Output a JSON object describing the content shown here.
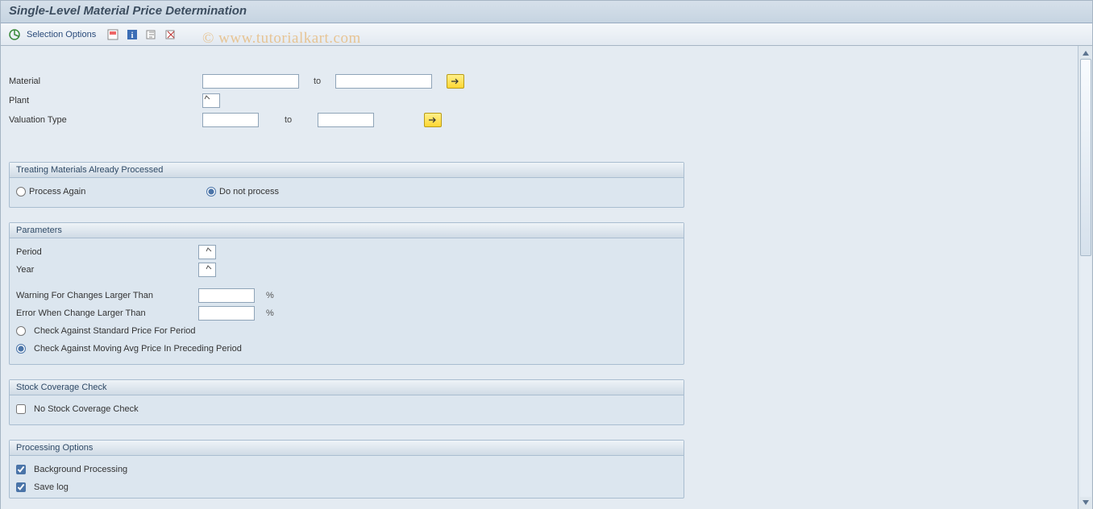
{
  "title": "Single-Level Material Price Determination",
  "toolbar": {
    "selection_options": "Selection Options"
  },
  "watermark": "© www.tutorialkart.com",
  "selection": {
    "material_label": "Material",
    "material_from": "",
    "material_to": "",
    "to_label": "to",
    "plant_label": "Plant",
    "plant_value": "",
    "valuation_label": "Valuation Type",
    "valuation_from": "",
    "valuation_to": ""
  },
  "group_processed": {
    "title": "Treating Materials Already Processed",
    "option_process_again": "Process Again",
    "option_do_not_process": "Do not process"
  },
  "group_parameters": {
    "title": "Parameters",
    "period_label": "Period",
    "period_value": "",
    "year_label": "Year",
    "year_value": "",
    "warning_label": "Warning For Changes Larger Than",
    "warning_value": "",
    "error_label": "Error When Change Larger Than",
    "error_value": "",
    "percent": "%",
    "option_standard": "Check Against Standard Price For Period",
    "option_moving_avg": "Check Against Moving Avg Price In Preceding Period"
  },
  "group_stock": {
    "title": "Stock Coverage Check",
    "no_stock_check": "No Stock Coverage Check"
  },
  "group_processing": {
    "title": "Processing Options",
    "background": "Background Processing",
    "save_log": "Save log"
  }
}
